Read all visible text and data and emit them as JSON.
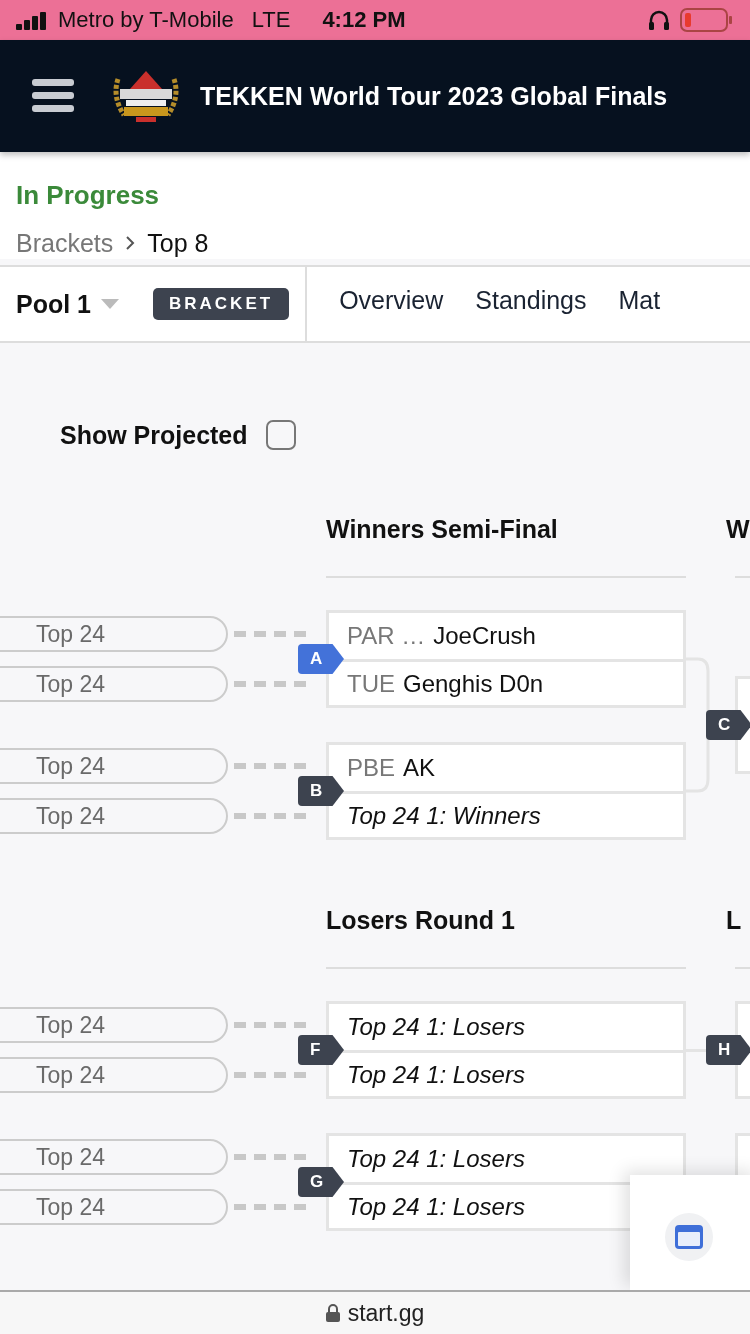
{
  "status_bar": {
    "carrier": "Metro by T-Mobile",
    "network": "LTE",
    "time": "4:12 PM"
  },
  "header": {
    "title": "TEKKEN World Tour 2023 Global Finals"
  },
  "status": "In Progress",
  "breadcrumb": [
    {
      "label": "Brackets"
    },
    {
      "label": "Top 8"
    }
  ],
  "pool": {
    "label": "Pool 1",
    "badge": "BRACKET"
  },
  "tabs": [
    {
      "label": "Overview",
      "selected": false
    },
    {
      "label": "Standings",
      "selected": false
    },
    {
      "label": "Mat",
      "selected": false
    }
  ],
  "show_projected": {
    "label": "Show Projected",
    "checked": false
  },
  "sections": [
    {
      "title": "Winners Semi-Final",
      "next_title": "W",
      "matches": [
        {
          "id": "A",
          "active": true,
          "slots": [
            {
              "feeder": "Top 24",
              "kind": "player",
              "prefix": "PAR …",
              "name": "JoeCrush"
            },
            {
              "feeder": "Top 24",
              "kind": "player",
              "prefix": "TUE",
              "name": "Genghis D0n"
            }
          ]
        },
        {
          "id": "B",
          "active": false,
          "slots": [
            {
              "feeder": "Top 24",
              "kind": "player",
              "prefix": "PBE",
              "name": "AK"
            },
            {
              "feeder": "Top 24",
              "kind": "projected",
              "name": "Top 24 1: Winners"
            }
          ]
        }
      ],
      "next_matches": [
        {
          "id": "C",
          "kind": "merge"
        }
      ]
    },
    {
      "title": "Losers Round 1",
      "next_title": "L",
      "matches": [
        {
          "id": "F",
          "active": false,
          "slots": [
            {
              "feeder": "Top 24",
              "kind": "projected",
              "name": "Top 24 1: Losers"
            },
            {
              "feeder": "Top 24",
              "kind": "projected",
              "name": "Top 24 1: Losers"
            }
          ]
        },
        {
          "id": "G",
          "active": false,
          "slots": [
            {
              "feeder": "Top 24",
              "kind": "projected",
              "name": "Top 24 1: Losers"
            },
            {
              "feeder": "Top 24",
              "kind": "projected",
              "name": "Top 24 1: Losers"
            }
          ]
        }
      ],
      "next_matches": [
        {
          "id": "H",
          "kind": "straight"
        }
      ]
    }
  ],
  "url_bar": {
    "url": "start.gg"
  }
}
